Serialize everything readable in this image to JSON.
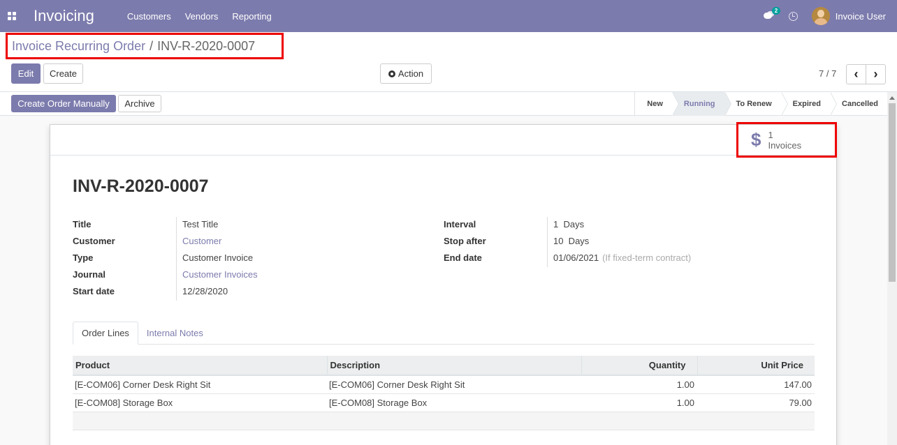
{
  "navbar": {
    "app_title": "Invoicing",
    "menu": [
      "Customers",
      "Vendors",
      "Reporting"
    ],
    "chat_count": "2",
    "user_name": "Invoice User"
  },
  "breadcrumb": {
    "parent": "Invoice Recurring Order",
    "separator": "/",
    "current": "INV-R-2020-0007"
  },
  "toolbar": {
    "edit_label": "Edit",
    "create_label": "Create",
    "action_label": "Action",
    "pager_value": "7 / 7",
    "pager_prev": "‹",
    "pager_next": "›"
  },
  "statusbar": {
    "create_manual_label": "Create Order Manually",
    "archive_label": "Archive",
    "steps": [
      "New",
      "Running",
      "To Renew",
      "Expired",
      "Cancelled"
    ],
    "active_step": "Running"
  },
  "smart_button": {
    "count": "1",
    "label": "Invoices"
  },
  "record": {
    "title": "INV-R-2020-0007",
    "left_fields": [
      {
        "label": "Title",
        "value": "Test Title"
      },
      {
        "label": "Customer",
        "value": "Customer"
      },
      {
        "label": "Type",
        "value": "Customer Invoice"
      },
      {
        "label": "Journal",
        "value": "Customer Invoices"
      },
      {
        "label": "Start date",
        "value": "12/28/2020"
      }
    ],
    "right_fields": [
      {
        "label": "Interval",
        "value": "1  Days"
      },
      {
        "label": "Stop after",
        "value": "10  Days"
      },
      {
        "label": "End date",
        "value": "01/06/2021",
        "help": "(If fixed-term contract)"
      }
    ]
  },
  "tabs": [
    "Order Lines",
    "Internal Notes"
  ],
  "order_lines": {
    "headers": [
      "Product",
      "Description",
      "Quantity",
      "Unit Price"
    ],
    "rows": [
      {
        "product": "[E-COM06] Corner Desk Right Sit",
        "description": "[E-COM06] Corner Desk Right Sit",
        "quantity": "1.00",
        "unit_price": "147.00"
      },
      {
        "product": "[E-COM08] Storage Box",
        "description": "[E-COM08] Storage Box",
        "quantity": "1.00",
        "unit_price": "79.00"
      }
    ]
  },
  "colors": {
    "brand": "#7c7bad",
    "highlight_box": "#ee0000"
  }
}
